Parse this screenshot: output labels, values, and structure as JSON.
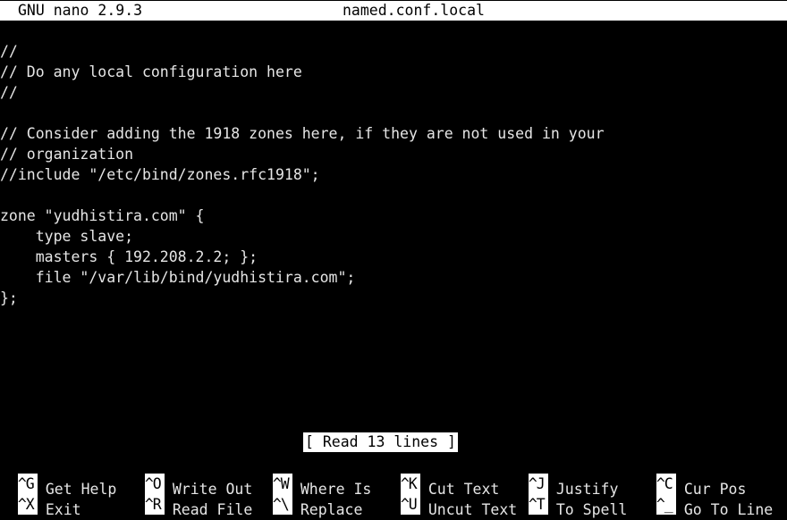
{
  "titlebar": {
    "version": "GNU nano 2.9.3",
    "filename": "named.conf.local"
  },
  "editor": {
    "lines": [
      "//",
      "// Do any local configuration here",
      "//",
      "",
      "// Consider adding the 1918 zones here, if they are not used in your",
      "// organization",
      "//include \"/etc/bind/zones.rfc1918\";",
      "",
      "zone \"yudhistira.com\" {",
      "    type slave;",
      "    masters { 192.208.2.2; };",
      "    file \"/var/lib/bind/yudhistira.com\";",
      "};"
    ]
  },
  "status": {
    "message": "[ Read 13 lines ]"
  },
  "shortcuts": {
    "row1": [
      {
        "key": "^G",
        "label": "Get Help"
      },
      {
        "key": "^O",
        "label": "Write Out"
      },
      {
        "key": "^W",
        "label": "Where Is"
      },
      {
        "key": "^K",
        "label": "Cut Text"
      },
      {
        "key": "^J",
        "label": "Justify"
      },
      {
        "key": "^C",
        "label": "Cur Pos"
      }
    ],
    "row2": [
      {
        "key": "^X",
        "label": "Exit"
      },
      {
        "key": "^R",
        "label": "Read File"
      },
      {
        "key": "^\\",
        "label": "Replace"
      },
      {
        "key": "^U",
        "label": "Uncut Text"
      },
      {
        "key": "^T",
        "label": "To Spell"
      },
      {
        "key": "^_",
        "label": "Go To Line"
      }
    ]
  },
  "colors": {
    "background": "#000000",
    "foreground": "#e6e6e6",
    "inverse_background": "#ffffff",
    "inverse_foreground": "#000000"
  }
}
